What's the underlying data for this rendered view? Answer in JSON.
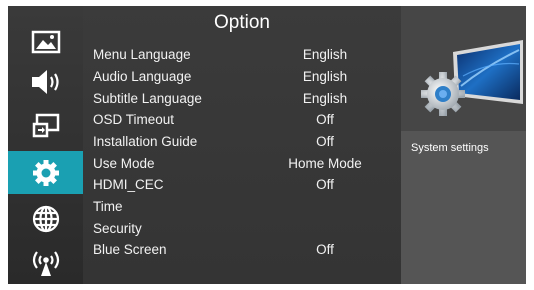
{
  "menu": {
    "title": "Option",
    "rows": [
      {
        "label": "Menu Language",
        "value": "English"
      },
      {
        "label": "Audio Language",
        "value": "English"
      },
      {
        "label": "Subtitle Language",
        "value": "English"
      },
      {
        "label": "OSD Timeout",
        "value": "Off"
      },
      {
        "label": "Installation Guide",
        "value": "Off"
      },
      {
        "label": "Use Mode",
        "value": "Home Mode"
      },
      {
        "label": "HDMI_CEC",
        "value": "Off"
      },
      {
        "label": "Time",
        "value": ""
      },
      {
        "label": "Security",
        "value": ""
      },
      {
        "label": "Blue Screen",
        "value": "Off"
      }
    ]
  },
  "sidebar": {
    "items": [
      {
        "icon": "picture-icon",
        "active": false
      },
      {
        "icon": "speaker-icon",
        "active": false
      },
      {
        "icon": "input-source-icon",
        "active": false
      },
      {
        "icon": "gear-icon",
        "active": true
      },
      {
        "icon": "globe-icon",
        "active": false
      },
      {
        "icon": "broadcast-icon",
        "active": false
      }
    ]
  },
  "info": {
    "description": "System settings"
  },
  "colors": {
    "accent": "#1aa0b2",
    "panel": "#3a3a3a",
    "right_panel": "#555555"
  }
}
